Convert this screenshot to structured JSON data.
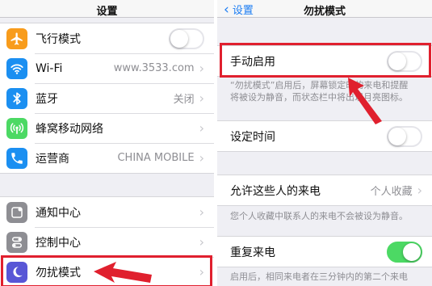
{
  "left": {
    "title": "设置",
    "group1": [
      {
        "label": "飞行模式",
        "icon": "airplane-icon",
        "color": "#f89c1c",
        "accessory": "toggle",
        "on": false
      },
      {
        "label": "Wi-Fi",
        "icon": "wifi-icon",
        "color": "#1b8ff1",
        "value": "www.3533.com",
        "accessory": "chevron"
      },
      {
        "label": "蓝牙",
        "icon": "bluetooth-icon",
        "color": "#1b8ff1",
        "value": "关闭",
        "accessory": "chevron"
      },
      {
        "label": "蜂窝移动网络",
        "icon": "cellular-icon",
        "color": "#4cd964",
        "accessory": "chevron"
      },
      {
        "label": "运营商",
        "icon": "phone-icon",
        "color": "#1b8ff1",
        "value": "CHINA MOBILE",
        "accessory": "chevron"
      }
    ],
    "group2": [
      {
        "label": "通知中心",
        "icon": "notification-center-icon",
        "color": "#8e8e93",
        "accessory": "chevron"
      },
      {
        "label": "控制中心",
        "icon": "control-center-icon",
        "color": "#8e8e93",
        "accessory": "chevron"
      },
      {
        "label": "勿扰模式",
        "icon": "moon-icon",
        "color": "#5856d6",
        "accessory": "chevron"
      }
    ]
  },
  "right": {
    "back": "设置",
    "title": "勿扰模式",
    "manual_label": "手动启用",
    "manual_on": false,
    "manual_note_line1": "“勿扰模式”启用后，屏幕锁定时的来电和提醒",
    "manual_note_line2": "将被设为静音，而状态栏中将出现月亮图标。",
    "scheduled_label": "设定时间",
    "scheduled_on": false,
    "allow_label": "允许这些人的来电",
    "allow_value": "个人收藏",
    "allow_note": "您个人收藏中联系人的来电不会被设为静音。",
    "repeat_label": "重复来电",
    "repeat_on": true,
    "repeat_note": "启用后，相同来电者在三分钟内的第二个来电"
  },
  "colors": {
    "accent": "#1a7cf3",
    "highlight": "#e0202e",
    "toggle_on": "#4cd964"
  }
}
